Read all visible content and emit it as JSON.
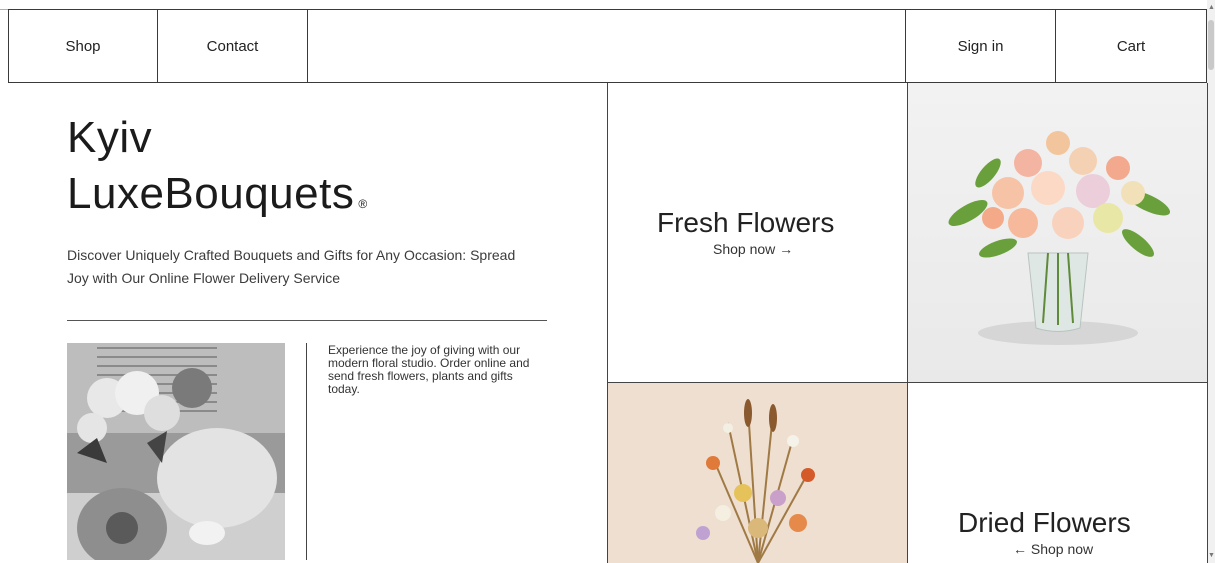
{
  "nav": {
    "shop": "Shop",
    "contact": "Contact",
    "signin": "Sign in",
    "cart": "Cart"
  },
  "hero": {
    "brand_line1": "Kyiv",
    "brand_line2": "LuxeBouquets",
    "registered_mark": "®",
    "tagline": "Discover Uniquely Crafted Bouquets and Gifts for Any Occasion: Spread Joy with Our Online Flower Delivery Service",
    "blurb": "Experience the joy of giving with our modern floral studio. Order online and send fresh flowers, plants and gifts today."
  },
  "tiles": {
    "fresh_title": "Fresh Flowers",
    "fresh_link": "Shop now →",
    "dried_title": "Dried Flowers",
    "dried_link": "← Shop now"
  },
  "colors": {
    "accent_line": "#9bb6c1",
    "text": "#1d1d1d",
    "border": "#3a3a3a",
    "dried_bg": "#efdfd0"
  }
}
